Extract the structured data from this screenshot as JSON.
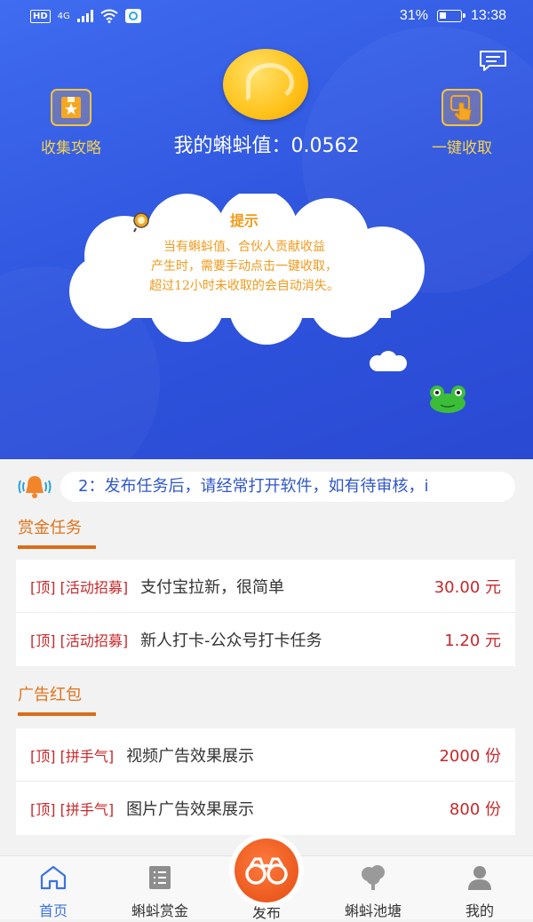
{
  "status_bar": {
    "hd": "HD",
    "network": "4G",
    "battery": "31%",
    "battery_level": 0.31,
    "time": "13:38"
  },
  "header": {
    "balance_label": "我的蝌蚪值：",
    "balance_value": "0.0562",
    "left_button": {
      "label": "收集攻略",
      "icon": "gift-card-icon"
    },
    "right_button": {
      "label": "一键收取",
      "icon": "tap-hand-icon"
    },
    "message_icon": "message-icon"
  },
  "tip": {
    "title": "提示",
    "lines": [
      "当有蝌蚪值、合伙人贡献收益",
      "产生时，需要手动点击一键收取，",
      "超过12小时未收取的会自动消失。"
    ]
  },
  "notice": {
    "text": "2：发布任务后，请经常打开软件，如有待审核，i"
  },
  "bounty_section": {
    "heading": "赏金任务",
    "rows": [
      {
        "tag": "[顶] [活动招募]",
        "title": "支付宝拉新，很简单",
        "reward": "30.00 元"
      },
      {
        "tag": "[顶] [活动招募]",
        "title": "新人打卡-公众号打卡任务",
        "reward": "1.20 元"
      }
    ]
  },
  "ad_section": {
    "heading": "广告红包",
    "rows": [
      {
        "tag": "[顶] [拼手气]",
        "title": "视频广告效果展示",
        "reward": "2000 份"
      },
      {
        "tag": "[顶] [拼手气]",
        "title": "图片广告效果展示",
        "reward": "800 份"
      }
    ]
  },
  "tabbar": {
    "tabs": [
      {
        "label": "首页",
        "icon": "home-icon"
      },
      {
        "label": "蝌蚪赏金",
        "icon": "list-icon"
      },
      {
        "label": "发布",
        "icon": "binoculars-icon"
      },
      {
        "label": "蝌蚪池塘",
        "icon": "tree-icon"
      },
      {
        "label": "我的",
        "icon": "user-icon"
      }
    ]
  },
  "colors": {
    "hero_blue": "#2f55de",
    "accent_orange": "#e0731a",
    "price_red": "#c7282b",
    "tab_active": "#3b74e0"
  }
}
